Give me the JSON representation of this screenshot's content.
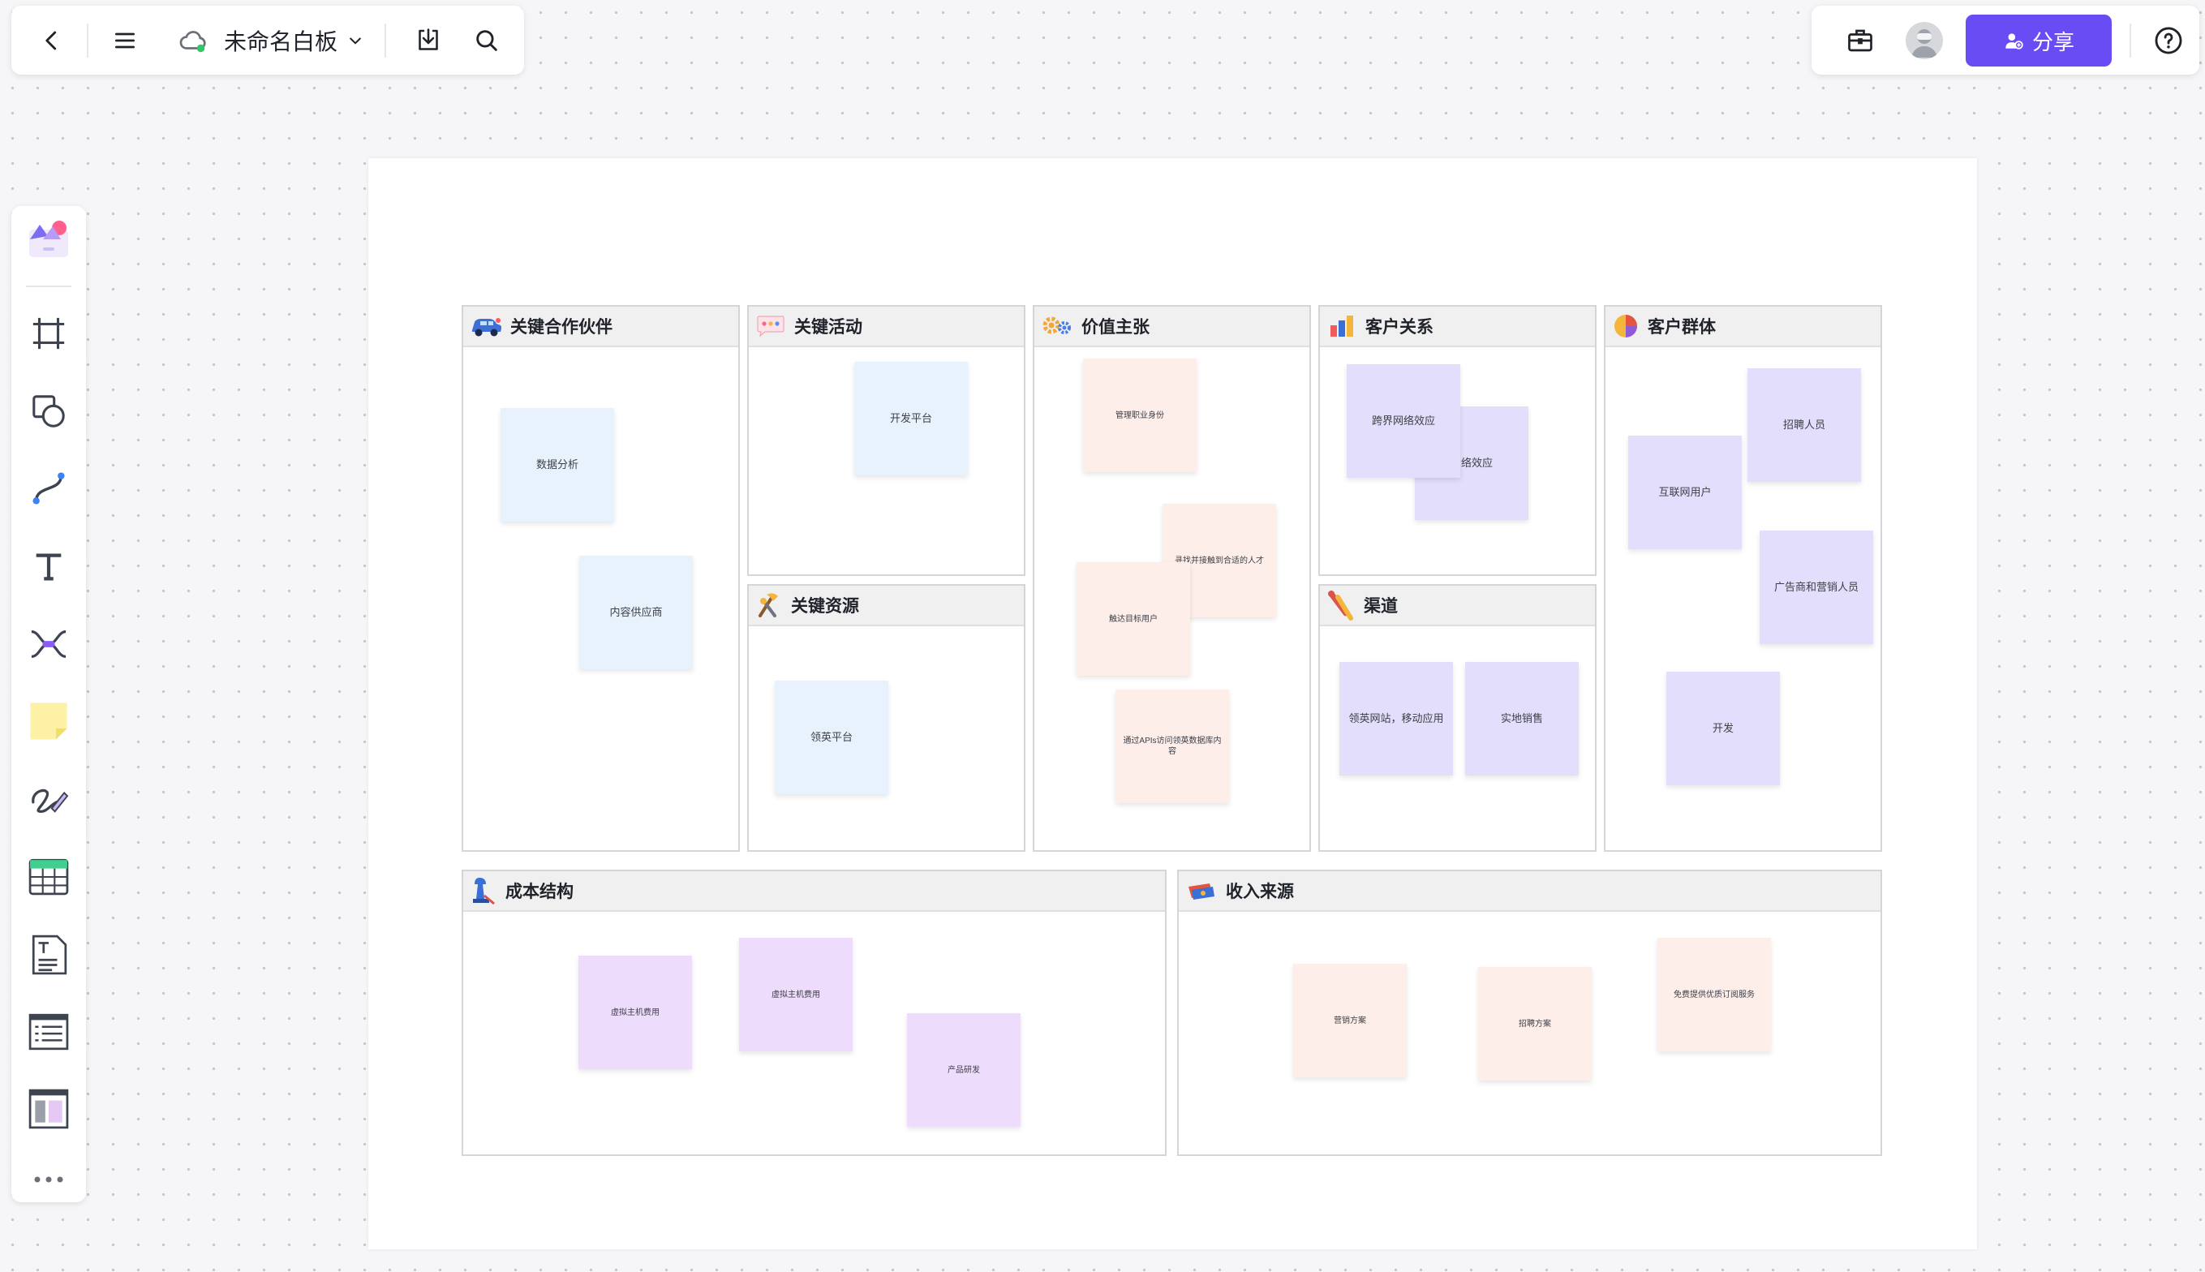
{
  "toolbar": {
    "doc_title": "未命名白板",
    "share_label": "分享"
  },
  "colors": {
    "accent": "#6a4cf5",
    "note_blue": "#e8f2fd",
    "note_pink": "#fdeeea",
    "note_violet": "#e2defb",
    "note_purple": "#eddcfb"
  },
  "sidebar": {
    "tools": [
      "templates-icon",
      "frame-icon",
      "shape-icon",
      "connector-icon",
      "text-icon",
      "mindmap-icon",
      "sticky-note-icon",
      "pen-icon",
      "table-icon",
      "doc-icon",
      "list-icon",
      "layout-icon",
      "more-icon"
    ]
  },
  "canvas": {
    "sections": {
      "key_partners": {
        "title": "关键合作伙伴",
        "notes": [
          "数据分析",
          "内容供应商"
        ]
      },
      "key_activities": {
        "title": "关键活动",
        "notes": [
          "开发平台"
        ]
      },
      "key_resources": {
        "title": "关键资源",
        "notes": [
          "领英平台"
        ]
      },
      "value_propositions": {
        "title": "价值主张",
        "notes": [
          "管理职业身份",
          "寻找并接触到合适的人才",
          "触达目标用户",
          "通过APIs访问领英数据库内容"
        ]
      },
      "customer_relationships": {
        "title": "客户关系",
        "notes": [
          "网络效应",
          "跨界网络效应"
        ]
      },
      "channels": {
        "title": "渠道",
        "notes": [
          "领英网站，移动应用",
          "实地销售"
        ]
      },
      "customer_segments": {
        "title": "客户群体",
        "notes": [
          "招聘人员",
          "互联网用户",
          "广告商和营销人员",
          "开发"
        ]
      },
      "cost_structure": {
        "title": "成本结构",
        "notes": [
          "虚拟主机费用",
          "虚拟主机费用",
          "产品研发"
        ]
      },
      "revenue_streams": {
        "title": "收入来源",
        "notes": [
          "营销方案",
          "招聘方案",
          "免费提供优质订阅服务"
        ]
      }
    }
  }
}
